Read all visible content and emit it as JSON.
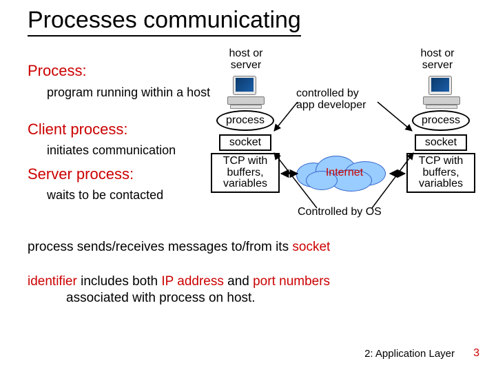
{
  "title": "Processes communicating",
  "left": {
    "process_term": "Process:",
    "process_def": "program running within a host",
    "client_term": "Client process:",
    "client_def": "initiates communication",
    "server_term": "Server process:",
    "server_def": "waits to be contacted"
  },
  "diagram": {
    "host_label_left": "host or\nserver",
    "host_label_right": "host or\nserver",
    "process_label": "process",
    "socket_label": "socket",
    "tcp_label": "TCP with\nbuffers,\nvariables",
    "internet_label": "Internet",
    "ctrl_dev": "controlled by\napp developer",
    "ctrl_os": "Controlled by OS"
  },
  "bottom": {
    "line1_pre": "process sends/receives messages to/from its ",
    "line1_hl": "socket",
    "line2_pre_hl": "identifier",
    "line2_pre": " includes both ",
    "line2_hl2": "IP address",
    "line2_mid": " and ",
    "line2_hl3": "port numbers",
    "line2_rest": "associated with process on host."
  },
  "footer": {
    "chapter": "2: Application Layer",
    "page": "3"
  }
}
